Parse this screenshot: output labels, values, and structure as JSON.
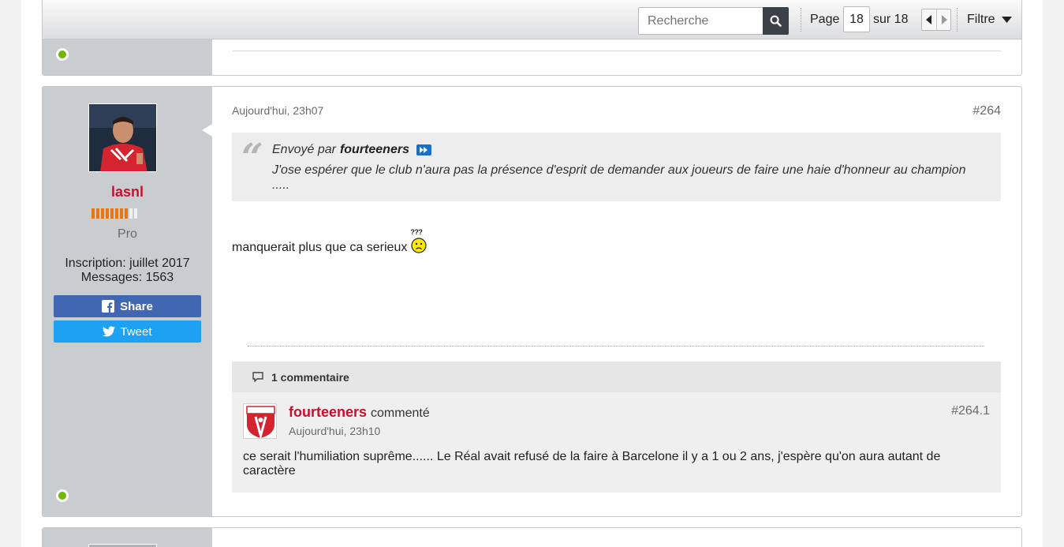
{
  "toolbar": {
    "search_placeholder": "Recherche",
    "page_label": "Page",
    "current_page": "18",
    "of_label": "sur 18",
    "filter_label": "Filtre"
  },
  "post": {
    "date": "Aujourd'hui, 23h07",
    "number": "#264",
    "author": {
      "username": "lasnl",
      "rank_title": "Pro",
      "rank_level": 8,
      "rank_max": 10,
      "joined": "Inscription: juillet 2017",
      "messages": "Messages: 1563"
    },
    "share_label": "Share",
    "tweet_label": "Tweet",
    "quote": {
      "prefix": "Envoyé par",
      "author": "fourteeners",
      "text": "J'ose espérer que le club n'aura pas la présence d'esprit de demander aux joueurs de faire une haie d'honneur au champion ....."
    },
    "body": "manquerait plus que ca serieux",
    "smiley_text": "???",
    "comments_count_label": "1 commentaire",
    "comment": {
      "username": "fourteeners",
      "verb": "commenté",
      "date": "Aujourd'hui, 23h10",
      "number": "#264.1",
      "text": "ce serait l'humiliation suprême...... Le Réal avait refusé de la faire à Barcelone il y a 1 ou 2 ans, j'espère qu'on aura autant de caractère"
    }
  },
  "colors": {
    "username_red": "#c8102e",
    "online_green": "#6fb802",
    "facebook_blue": "#4267b2",
    "twitter_blue": "#1da1f2",
    "rank_orange": "#e97611",
    "sidebar_gray": "#c9cdd0"
  },
  "icons": {
    "search": "search-icon",
    "prev": "caret-left-icon",
    "next": "caret-right-icon",
    "filter": "caret-down-icon",
    "facebook": "facebook-icon",
    "twitter": "twitter-icon",
    "comment": "comment-icon",
    "goto_post": "goto-post-icon"
  }
}
